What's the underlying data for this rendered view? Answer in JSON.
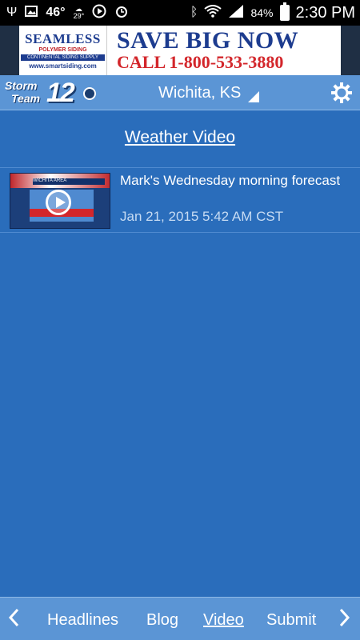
{
  "status_bar": {
    "temperature": "46°",
    "weather_small": "29°",
    "battery": "84%",
    "time": "2:30 PM",
    "icons": [
      "usb-icon",
      "image-icon",
      "weather-icon",
      "media-icon",
      "alarm-icon",
      "bluetooth-icon",
      "wifi-icon",
      "signal-icon",
      "battery-icon"
    ]
  },
  "ad": {
    "brand": "SEAMLESS",
    "brand_sub": "POLYMER SIDING",
    "supplier": "CONTINENTAL SIDING SUPPLY",
    "url": "www.smartsiding.com",
    "headline": "SAVE BIG NOW",
    "phone": "CALL 1-800-533-3880"
  },
  "header": {
    "logo_storm": "Storm",
    "logo_team": "Team",
    "logo_number": "12",
    "location": "Wichita, KS",
    "settings_icon": "gear-icon"
  },
  "main": {
    "section_title": "Weather Video",
    "videos": [
      {
        "title": "Mark's Wednesday morning forecast",
        "date": "Jan 21, 2015 5:42 AM CST",
        "thumbnail_label": "WICHITA AREA"
      }
    ]
  },
  "bottom_nav": {
    "prev_icon": "chevron-left-icon",
    "next_icon": "chevron-right-icon",
    "items": [
      "Headlines",
      "Blog",
      "Video",
      "Submit"
    ],
    "active": "Video"
  },
  "colors": {
    "background": "#2a6dbb",
    "header": "#5b95d5",
    "ad_blue": "#1d3c8f",
    "ad_red": "#d3262b"
  }
}
